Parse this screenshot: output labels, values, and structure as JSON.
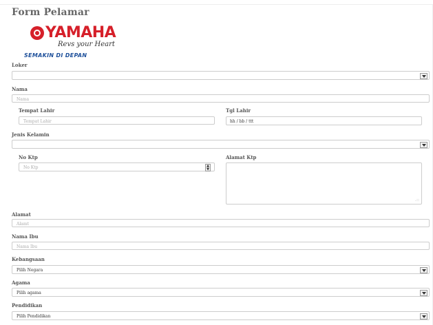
{
  "form": {
    "title": "Form Pelamar"
  },
  "brand": {
    "name": "YAMAHA",
    "tagline": "Revs your Heart",
    "slogan": "SEMAKIN DI DEPAN"
  },
  "fields": {
    "loker": {
      "label": "Loker",
      "value": ""
    },
    "nama": {
      "label": "Nama",
      "placeholder": "Nama"
    },
    "tempat_lahir": {
      "label": "Tempat Lahir",
      "placeholder": "Tempat Lahir"
    },
    "tgl_lahir": {
      "label": "Tgl Lahir",
      "value": "hh / bb / ttt"
    },
    "jenis_kelamin": {
      "label": "Jenis Kelamin",
      "value": ""
    },
    "no_ktp": {
      "label": "No Ktp",
      "placeholder": "No Ktp"
    },
    "alamat_ktp": {
      "label": "Alamat Ktp",
      "value": ""
    },
    "alamat": {
      "label": "Alamat",
      "placeholder": "Alamt"
    },
    "nama_ibu": {
      "label": "Nama Ibu",
      "placeholder": "Nama Ibu"
    },
    "kebangsaan": {
      "label": "Kebangsaan",
      "value": "Pilih Negara"
    },
    "agama": {
      "label": "Agama",
      "value": "Pilih agama"
    },
    "pendidikan": {
      "label": "Pendidikan",
      "value": "Pilih Pendidikan"
    }
  },
  "icons": {
    "select": "chevron-down-icon",
    "spinner": "spinner-arrows-icon",
    "resize": "resize-grip-icon",
    "logo": "yamaha-tuning-fork-logo"
  },
  "colors": {
    "brand_red": "#d6202a",
    "slogan_blue": "#1d4f9a",
    "border": "#cccccc"
  }
}
